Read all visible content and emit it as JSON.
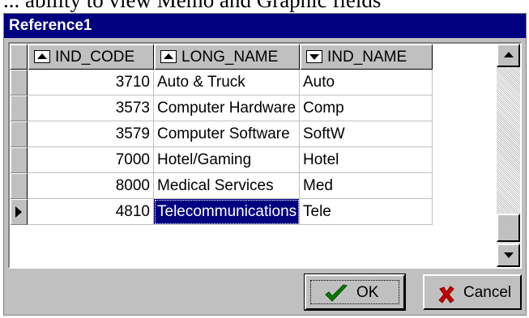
{
  "above_text": "... ability to view Memo and Graphic fields",
  "window": {
    "title": "Reference1"
  },
  "grid": {
    "columns": [
      {
        "label": "IND_CODE",
        "sort": "up"
      },
      {
        "label": "LONG_NAME",
        "sort": "up"
      },
      {
        "label": "IND_NAME",
        "sort": "down"
      }
    ],
    "rows": [
      {
        "code": "3710",
        "long_name": "Auto & Truck",
        "ind_name": "Auto"
      },
      {
        "code": "3573",
        "long_name": "Computer Hardware",
        "ind_name": "Comp"
      },
      {
        "code": "3579",
        "long_name": "Computer Software",
        "ind_name": "SoftW"
      },
      {
        "code": "7000",
        "long_name": "Hotel/Gaming",
        "ind_name": "Hotel"
      },
      {
        "code": "8000",
        "long_name": "Medical Services",
        "ind_name": "Med"
      },
      {
        "code": "4810",
        "long_name": "Telecommunications",
        "ind_name": "Tele"
      }
    ],
    "current_row_index": 5,
    "selected_cell": "long_name"
  },
  "buttons": {
    "ok_label": "OK",
    "cancel_label": "Cancel"
  },
  "icons": {
    "ok": "check-icon",
    "cancel": "x-icon"
  },
  "colors": {
    "title_bar": "#000080",
    "face": "#c0c0c0",
    "selection": "#000080",
    "check": "#008000",
    "cancel_x": "#cc0000"
  }
}
